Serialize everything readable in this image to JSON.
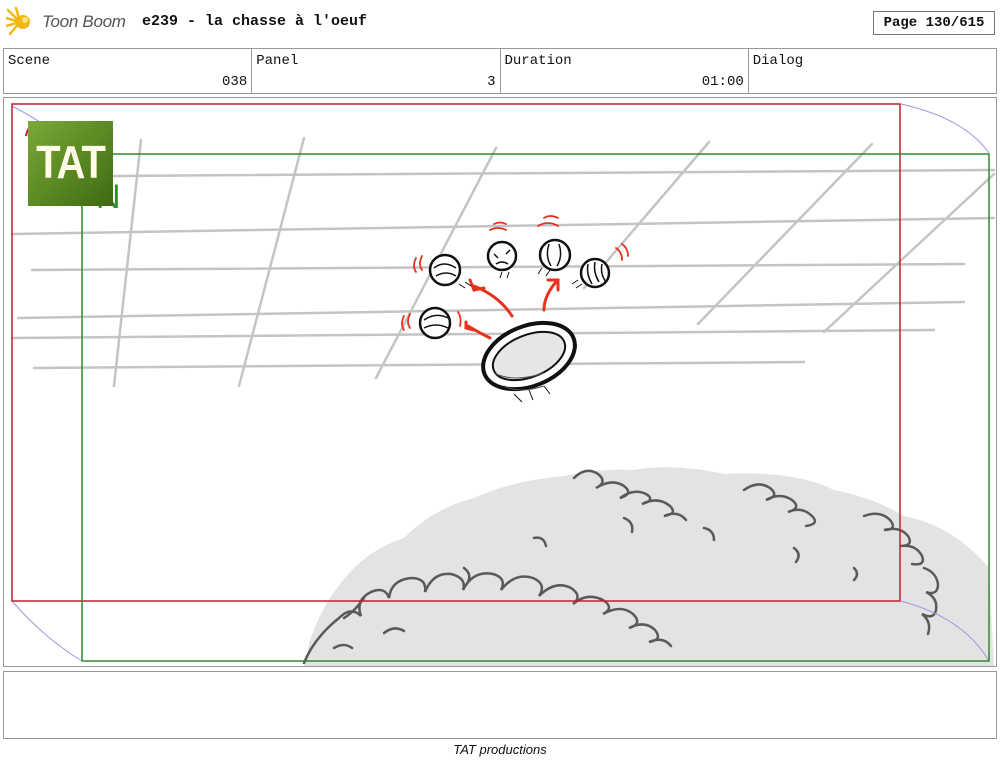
{
  "header": {
    "app_name": "Toon Boom",
    "title": "e239 - la chasse à l'oeuf",
    "page": "Page 130/615"
  },
  "fields": [
    {
      "label": "Scene",
      "value": "038"
    },
    {
      "label": "Panel",
      "value": "3"
    },
    {
      "label": "Duration",
      "value": "01:00"
    },
    {
      "label": "Dialog",
      "value": ""
    }
  ],
  "panel": {
    "logo_text": "TAT",
    "colors": {
      "camera_frame_red": "#c0202a",
      "camera_frame_green": "#2e8b2e",
      "motion_arrows": "#e8321e",
      "bush_fill": "#e3e3e3"
    }
  },
  "notes": "",
  "footer": "TAT productions"
}
